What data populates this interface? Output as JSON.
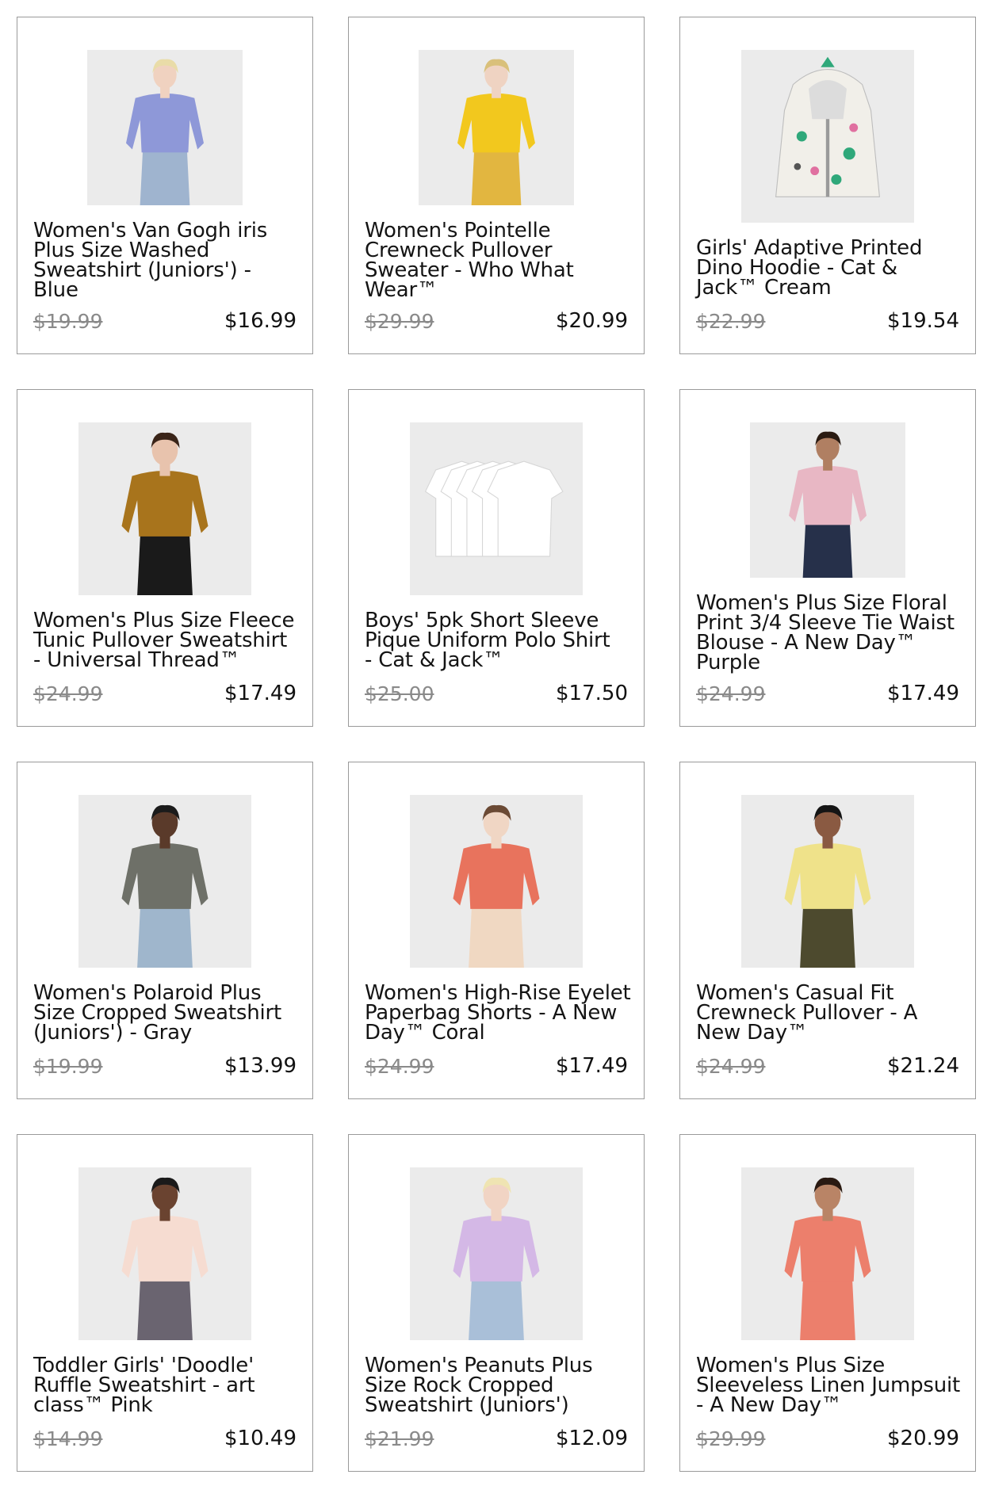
{
  "products": [
    {
      "title": "Women's Van Gogh iris\nPlus Size Washed\nSweatshirt (Juniors') -\nBlue",
      "old_price": "$19.99",
      "price": "$16.99",
      "colors": {
        "top": "#8e98d8",
        "bottom": "#9fb4cf",
        "skin": "#f0d2c0",
        "hair": "#e9dca8"
      }
    },
    {
      "title": "Women's Pointelle\nCrewneck Pullover\nSweater - Who What\nWear™",
      "old_price": "$29.99",
      "price": "$20.99",
      "colors": {
        "top": "#f2c81e",
        "bottom": "#e2b640",
        "skin": "#efd3c2",
        "hair": "#d9c07a"
      }
    },
    {
      "title": "Girls' Adaptive Printed\nDino Hoodie - Cat &\nJack™ Cream",
      "old_price": "$22.99",
      "price": "$19.54",
      "colors": {
        "top": "#f1efe9",
        "bottom": "#f1efe9",
        "accent": "#2fa87a"
      }
    },
    {
      "title": "Women's Plus Size Fleece\nTunic Pullover Sweatshirt\n- Universal Thread™",
      "old_price": "$24.99",
      "price": "$17.49",
      "colors": {
        "top": "#a8741c",
        "bottom": "#1a1a1a",
        "skin": "#e8c3ad",
        "hair": "#3a2418"
      }
    },
    {
      "title": "Boys' 5pk Short Sleeve\nPique Uniform Polo Shirt\n- Cat & Jack™",
      "old_price": "$25.00",
      "price": "$17.50",
      "colors": {
        "top": "#fbfbfb",
        "bottom": "#fbfbfb"
      }
    },
    {
      "title": "Women's Plus Size Floral\nPrint 3/4 Sleeve Tie Waist\nBlouse - A New Day™\nPurple",
      "old_price": "$24.99",
      "price": "$17.49",
      "colors": {
        "top": "#e8b7c4",
        "bottom": "#26304a",
        "skin": "#b07f62",
        "hair": "#2a1b12"
      }
    },
    {
      "title": "Women's Polaroid Plus\nSize Cropped Sweatshirt\n(Juniors') - Gray",
      "old_price": "$19.99",
      "price": "$13.99",
      "colors": {
        "top": "#6e7068",
        "bottom": "#9fb6cc",
        "skin": "#5a3a2a",
        "hair": "#1b1b1b"
      }
    },
    {
      "title": "Women's High-Rise Eyelet\nPaperbag Shorts - A New\nDay™ Coral",
      "old_price": "$24.99",
      "price": "$17.49",
      "colors": {
        "top": "#e8735d",
        "bottom": "#f0d8c2",
        "skin": "#f0d6c4"
      }
    },
    {
      "title": "Women's Casual Fit\nCrewneck Pullover - A\nNew Day™",
      "old_price": "$24.99",
      "price": "$21.24",
      "colors": {
        "top": "#efe28a",
        "bottom": "#4d4a2e",
        "skin": "#8a5a42",
        "hair": "#151515"
      }
    },
    {
      "title": "Toddler Girls' 'Doodle'\nRuffle Sweatshirt - art\nclass™ Pink",
      "old_price": "$14.99",
      "price": "$10.49",
      "colors": {
        "top": "#f6dcd1",
        "bottom": "#6a6470",
        "skin": "#6a4330",
        "hair": "#1a1a1a"
      }
    },
    {
      "title": "Women's Peanuts Plus\nSize Rock Cropped\nSweatshirt (Juniors')",
      "old_price": "$21.99",
      "price": "$12.09",
      "colors": {
        "top": "#d4b8e6",
        "bottom": "#a9bfd8",
        "skin": "#f1d4c4",
        "hair": "#efe4b2"
      }
    },
    {
      "title": "Women's Plus Size\nSleeveless Linen Jumpsuit\n- A New Day™",
      "old_price": "$29.99",
      "price": "$20.99",
      "colors": {
        "top": "#ec7f6c",
        "bottom": "#ec7f6c",
        "skin": "#b98466",
        "hair": "#2a1a12"
      }
    }
  ]
}
